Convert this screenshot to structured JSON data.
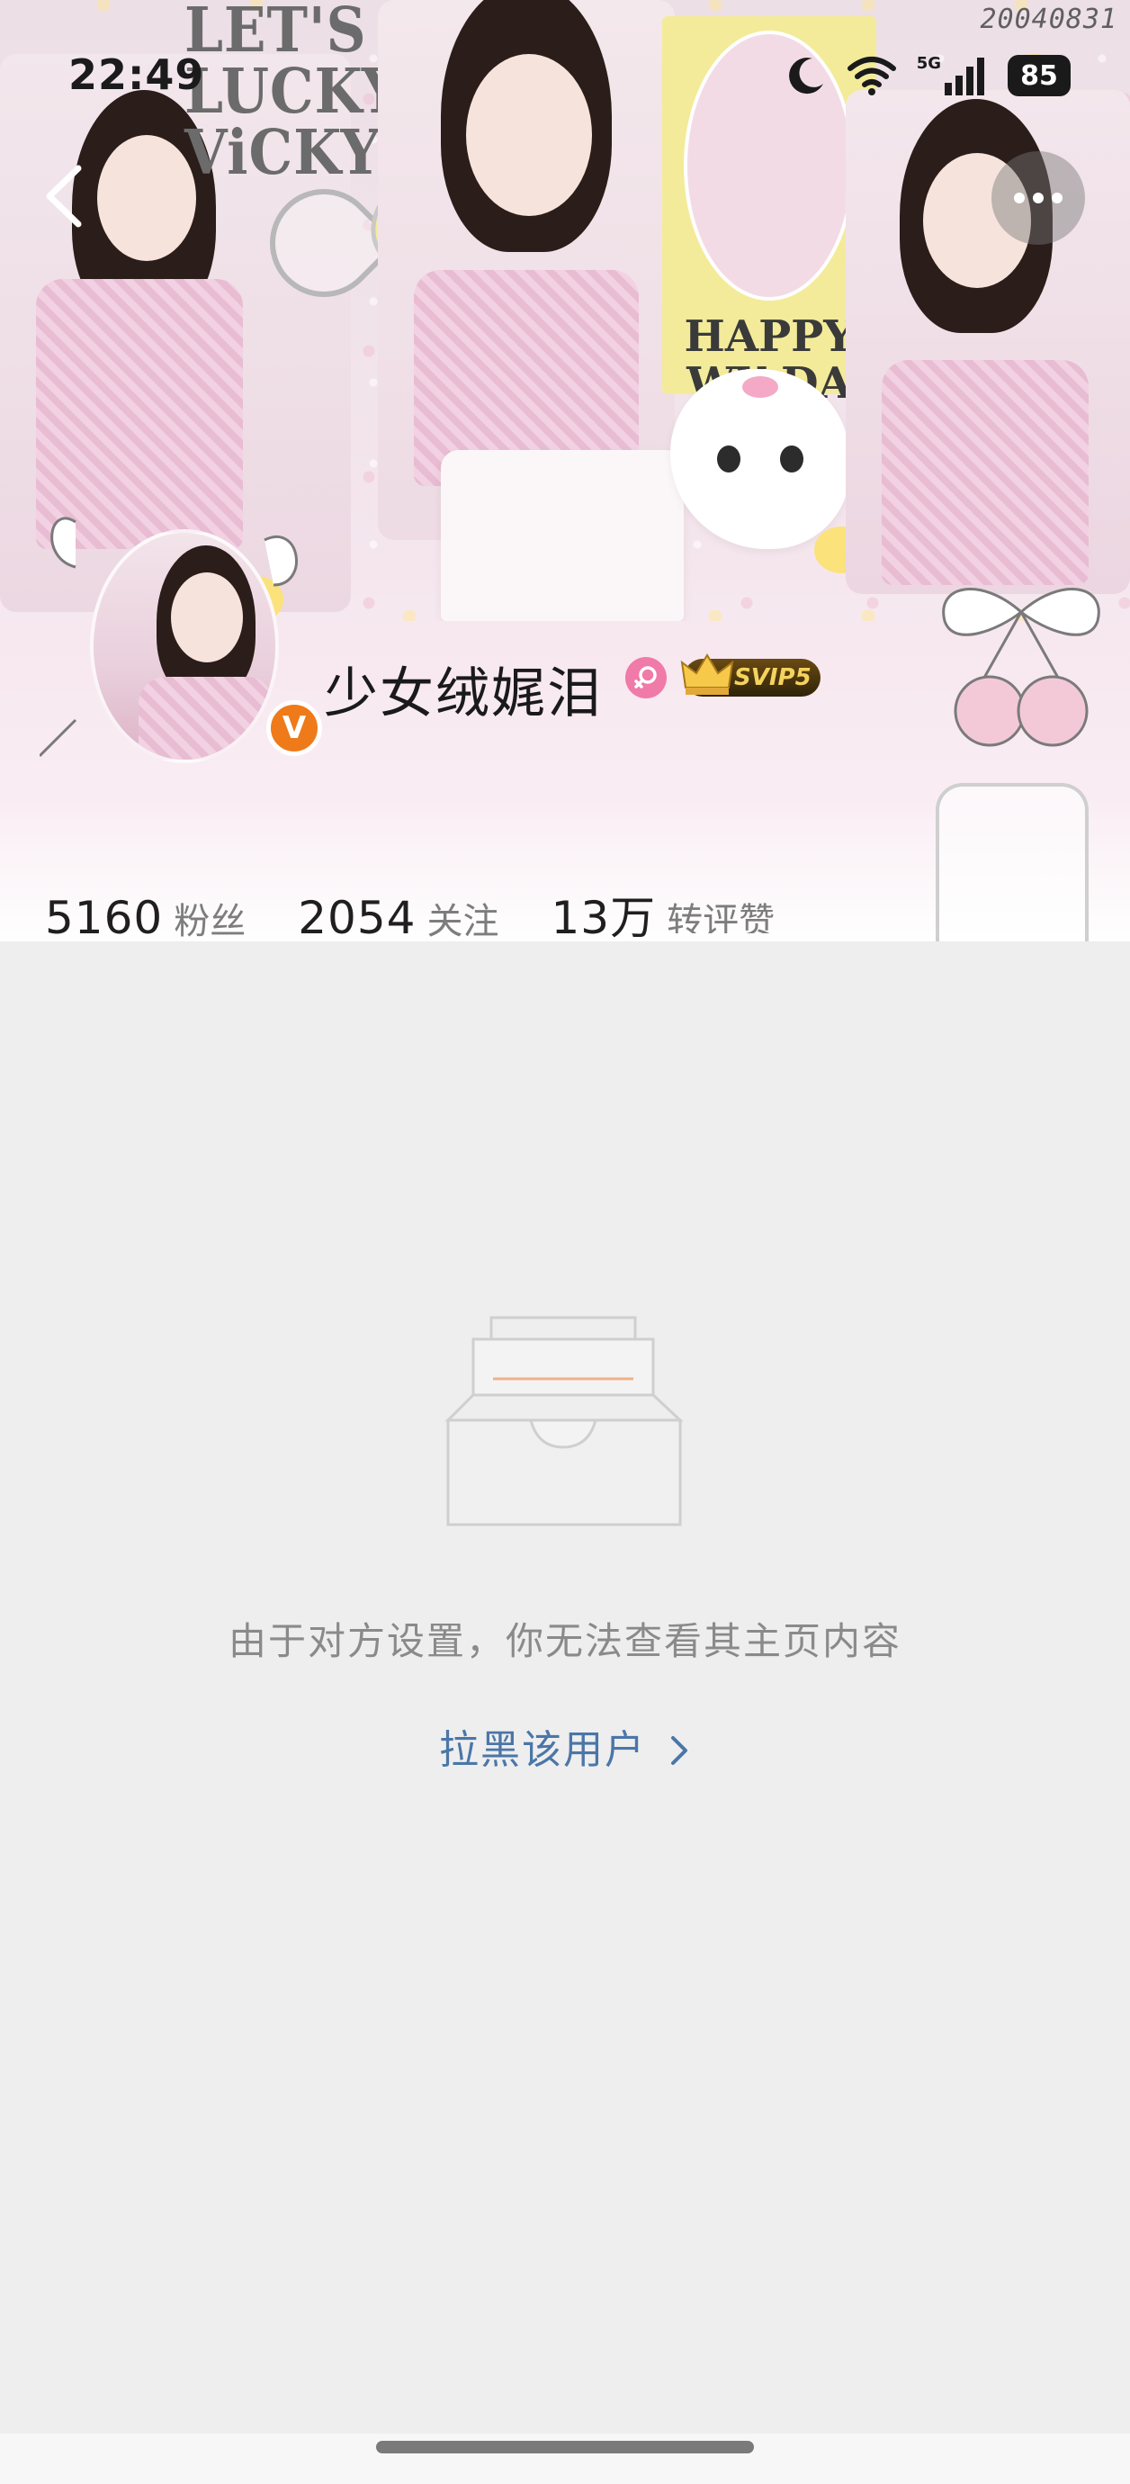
{
  "status_bar": {
    "time": "22:49",
    "network": "5G",
    "battery": "85",
    "icons": [
      "moon-icon",
      "wifi-icon",
      "signal-icon",
      "battery-icon"
    ]
  },
  "cover": {
    "stamp": "20040831",
    "lettering": [
      "LET'S",
      "LUCKY",
      "ViCKY"
    ],
    "card_text": [
      "HAPPY",
      "WY DA"
    ]
  },
  "nav": {
    "back_icon": "chevron-left-icon",
    "more_icon": "more-dots-icon"
  },
  "profile": {
    "username": "少女绒娓泪",
    "verified_mark": "V",
    "svip_label": "SVIP5",
    "stats": [
      {
        "number": "5160",
        "label": "粉丝"
      },
      {
        "number": "2054",
        "label": "关注"
      },
      {
        "number": "13万",
        "label": "转评赞"
      }
    ]
  },
  "empty_state": {
    "message": "由于对方设置，你无法查看其主页内容",
    "action": "拉黑该用户",
    "action_icon": "chevron-right-icon"
  },
  "colors": {
    "link": "#4b76a8",
    "verified": "#ef7a1a",
    "gender_female": "#f07aa8",
    "background": "#eeeeee"
  }
}
